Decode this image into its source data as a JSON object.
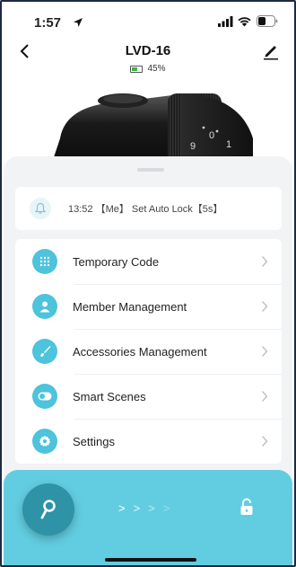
{
  "status_bar": {
    "time": "1:57"
  },
  "header": {
    "title": "LVD-16",
    "battery_label": "45%"
  },
  "battery": {
    "level": 0.45
  },
  "log": {
    "text": "13:52 【Me】 Set Auto Lock【5s】"
  },
  "menu": {
    "items": [
      {
        "label": "Temporary Code",
        "icon": "keypad-grid-icon"
      },
      {
        "label": "Member Management",
        "icon": "person-icon"
      },
      {
        "label": "Accessories Management",
        "icon": "brush-icon"
      },
      {
        "label": "Smart Scenes",
        "icon": "toggle-icon"
      },
      {
        "label": "Settings",
        "icon": "gear-icon"
      }
    ]
  },
  "lock_display": {
    "digits": [
      "9",
      "0",
      "1"
    ]
  },
  "unlock": {
    "arrows": [
      ">",
      ">",
      ">",
      ">"
    ]
  },
  "colors": {
    "accent": "#4dc3dc",
    "unlock_bg": "#62cde0",
    "key_button": "#2e93a7"
  }
}
